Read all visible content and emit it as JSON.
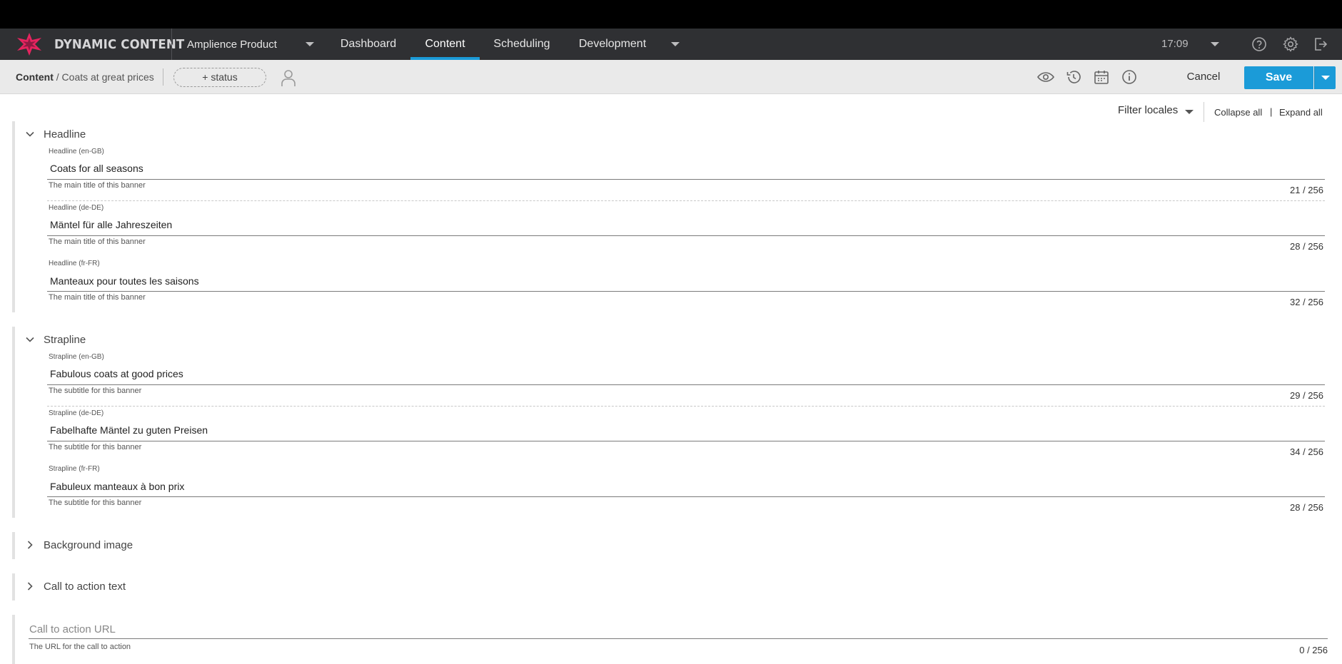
{
  "brand": {
    "name": "DYNAMIC CONTENT",
    "accent": "#e6245f"
  },
  "nav": {
    "hub": "Amplience Product",
    "tabs": [
      {
        "label": "Dashboard"
      },
      {
        "label": "Content"
      },
      {
        "label": "Scheduling"
      },
      {
        "label": "Development"
      }
    ],
    "active_tab": "Content",
    "time": "17:09",
    "icons": [
      "help-icon",
      "gear-icon",
      "logout-icon"
    ]
  },
  "toolbar": {
    "crumb_root": "Content",
    "crumb_current": "/ Coats at great prices",
    "status_label": "+ status",
    "cancel_label": "Cancel",
    "save_label": "Save",
    "icons": [
      "eye-icon",
      "history-icon",
      "calendar-icon",
      "info-icon"
    ],
    "accent": "#1b9bd8"
  },
  "controls": {
    "filter_locales": "Filter locales",
    "collapse_all": "Collapse all",
    "pipe": "|",
    "expand_all": "Expand all"
  },
  "headline": {
    "title": "Headline",
    "locales": [
      {
        "label": "Headline (en-GB)",
        "value": "Coats for all seasons",
        "help": "The main title of this banner",
        "count": "21 / 256"
      },
      {
        "label": "Headline (de-DE)",
        "value": "Mäntel für alle Jahreszeiten",
        "help": "The main title of this banner",
        "count": "28 / 256"
      },
      {
        "label": "Headline (fr-FR)",
        "value": "Manteaux pour toutes les saisons",
        "help": "The main title of this banner",
        "count": "32 / 256"
      }
    ]
  },
  "strapline": {
    "title": "Strapline",
    "locales": [
      {
        "label": "Strapline (en-GB)",
        "value": "Fabulous coats at good prices",
        "help": "The subtitle for this banner",
        "count": "29 / 256"
      },
      {
        "label": "Strapline (de-DE)",
        "value": "Fabelhafte Mäntel zu guten Preisen",
        "help": "The subtitle for this banner",
        "count": "34 / 256"
      },
      {
        "label": "Strapline (fr-FR)",
        "value": "Fabuleux manteaux à bon prix",
        "help": "The subtitle for this banner",
        "count": "28 / 256"
      }
    ]
  },
  "background_image": {
    "title": "Background image"
  },
  "cta_text": {
    "title": "Call to action text"
  },
  "cta_url": {
    "placeholder": "Call to action URL",
    "help": "The URL for the call to action",
    "count": "0 / 256"
  }
}
